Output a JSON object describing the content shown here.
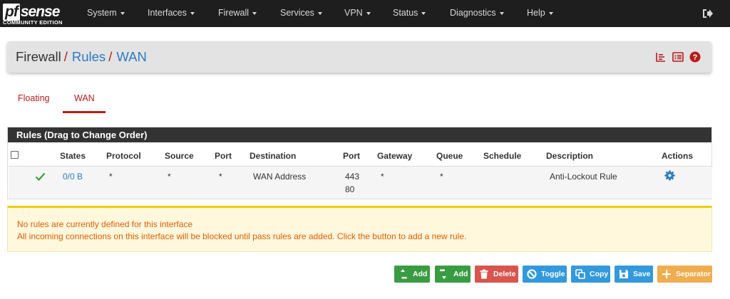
{
  "brand": {
    "name": "sense",
    "mark": "pf",
    "edition": "COMMUNITY EDITION"
  },
  "nav": {
    "items": [
      {
        "label": "System"
      },
      {
        "label": "Interfaces"
      },
      {
        "label": "Firewall"
      },
      {
        "label": "Services"
      },
      {
        "label": "VPN"
      },
      {
        "label": "Status"
      },
      {
        "label": "Diagnostics"
      },
      {
        "label": "Help"
      }
    ],
    "logout_icon": "sign-out-icon"
  },
  "breadcrumb": {
    "root": "Firewall",
    "section": "Rules",
    "current": "WAN",
    "separator": "/"
  },
  "header_icons": [
    "chart-icon",
    "list-icon",
    "help-icon"
  ],
  "tabs": [
    {
      "label": "Floating",
      "active": false
    },
    {
      "label": "WAN",
      "active": true
    }
  ],
  "rules_panel": {
    "title": "Rules (Drag to Change Order)",
    "columns": [
      "States",
      "Protocol",
      "Source",
      "Port",
      "Destination",
      "Port",
      "Gateway",
      "Queue",
      "Schedule",
      "Description",
      "Actions"
    ],
    "rows": [
      {
        "status_icon": "check-icon",
        "states": "0/0 B",
        "protocol": "*",
        "source": "*",
        "source_port": "*",
        "destination": "WAN Address",
        "dest_port_1": "443",
        "dest_port_2": "80",
        "gateway": "*",
        "queue": "*",
        "schedule": "",
        "description": "Anti-Lockout Rule",
        "action_icon": "gear-icon"
      }
    ]
  },
  "warning": {
    "line1": "No rules are currently defined for this interface",
    "line2": "All incoming connections on this interface will be blocked until pass rules are added. Click the button to add a new rule."
  },
  "buttons": {
    "add_top": "Add",
    "add_bottom": "Add",
    "delete": "Delete",
    "toggle": "Toggle",
    "copy": "Copy",
    "save": "Save",
    "separator": "Separator"
  },
  "colors": {
    "navbar": "#1e1e1e",
    "accent_red": "#b71c1c",
    "link_blue": "#2d7bc4",
    "success": "#3a9c42",
    "danger": "#d9534f",
    "info": "#3399dd",
    "warning": "#f0ad4e"
  }
}
